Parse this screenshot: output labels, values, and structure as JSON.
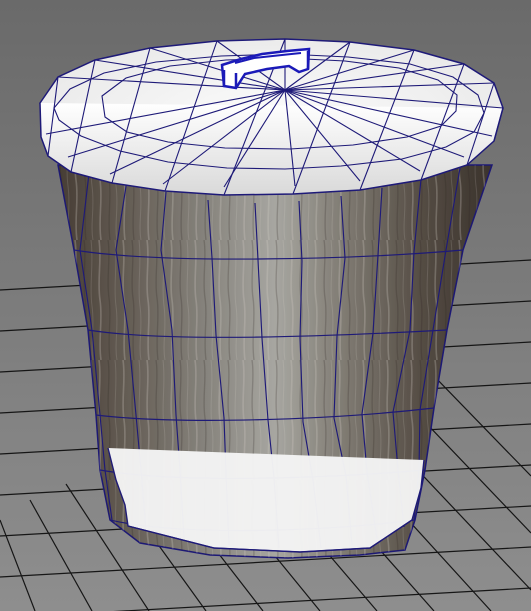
{
  "viewport": {
    "background_top": "#6b6b6b",
    "background_bottom": "#8a8a8a",
    "grid_color": "#111111",
    "wireframe_color": "#1d1a7a"
  },
  "model": {
    "icon": "trash-can-3d-model",
    "lid_color": "#f2f2f2",
    "band_color": "#f0f0f0",
    "handle_color": "#1b1ab8",
    "body_texture_colors": [
      "#6a5f54",
      "#9a9890",
      "#4f463d",
      "#7d7a73",
      "#b3b0a8"
    ]
  }
}
